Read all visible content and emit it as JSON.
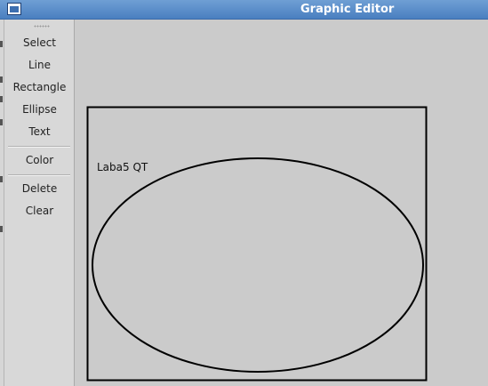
{
  "window": {
    "title": "Graphic Editor"
  },
  "toolbar": {
    "tools": [
      "Select",
      "Line",
      "Rectangle",
      "Ellipse",
      "Text"
    ],
    "color_label": "Color",
    "delete_label": "Delete",
    "clear_label": "Clear"
  },
  "canvas": {
    "text_label": "Laba5 QT",
    "shapes": [
      "rectangle",
      "ellipse"
    ]
  }
}
